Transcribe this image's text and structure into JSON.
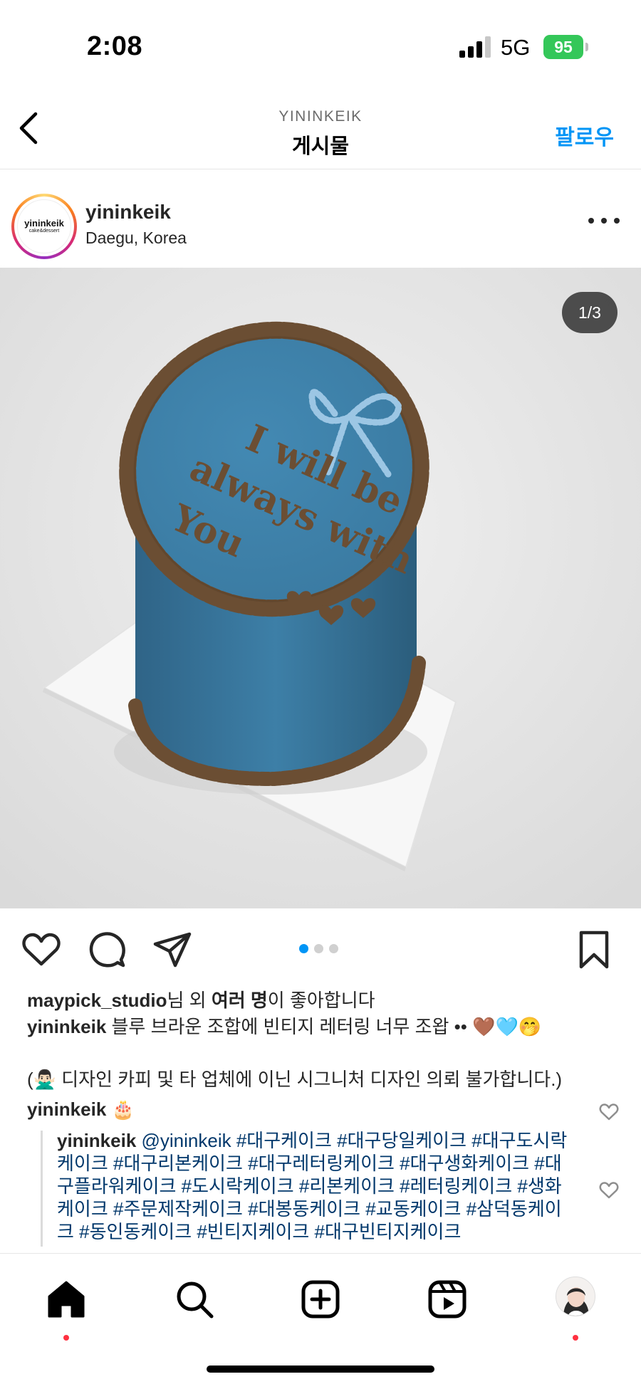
{
  "status_bar": {
    "time": "2:08",
    "network": "5G",
    "battery": "95"
  },
  "nav": {
    "subtitle": "YININKEIK",
    "title": "게시물",
    "follow_label": "팔로우"
  },
  "post": {
    "avatar_logo_main": "yininkeik",
    "avatar_logo_sub": "cake&dessert",
    "username": "yininkeik",
    "location": "Daegu, Korea",
    "image_counter": "1/3",
    "image_text": [
      "I will be",
      "always with",
      "You"
    ],
    "carousel": {
      "count": 3,
      "active": 0
    }
  },
  "likes": {
    "user": "maypick_studio",
    "text_1": "님 외 ",
    "others": "여러 명",
    "text_2": "이 좋아합니다"
  },
  "caption": {
    "username": "yininkeik",
    "text": "블루 브라운 조합에 빈티지 레터링 너무 조왑 •• 🤎🩵🤭",
    "notice": "(🙅🏻‍♂️ 디자인 카피 및 타 업체에 이닌 시그니처 디자인 의뢰 불가합니다.)"
  },
  "comments": [
    {
      "username": "yininkeik",
      "text": "🎂"
    },
    {
      "username": "yininkeik",
      "text": "@yininkeik #대구케이크 #대구당일케이크 #대구도시락케이크 #대구리본케이크 #대구레터링케이크 #대구생화케이크 #대구플라워케이크 #도시락케이크 #리본케이크 #레터링케이크 #생화케이크 #주문제작케이크 #대봉동케이크 #교동케이크 #삼덕동케이크 #동인동케이크 #빈티지케이크 #대구빈티지케이크"
    }
  ],
  "colors": {
    "accent_blue": "#0095f6",
    "hashtag_blue": "#00376b",
    "cake_blue": "#3d7fa7",
    "cake_brown": "#6b4e33",
    "notification_red": "#ff3040"
  },
  "icons": {
    "back": "chevron-left-icon",
    "more": "more-horizontal-icon",
    "like": "heart-icon",
    "comment": "comment-icon",
    "share": "paper-plane-icon",
    "save": "bookmark-icon",
    "home": "home-icon",
    "search": "search-icon",
    "create": "plus-square-icon",
    "reels": "reels-icon"
  }
}
